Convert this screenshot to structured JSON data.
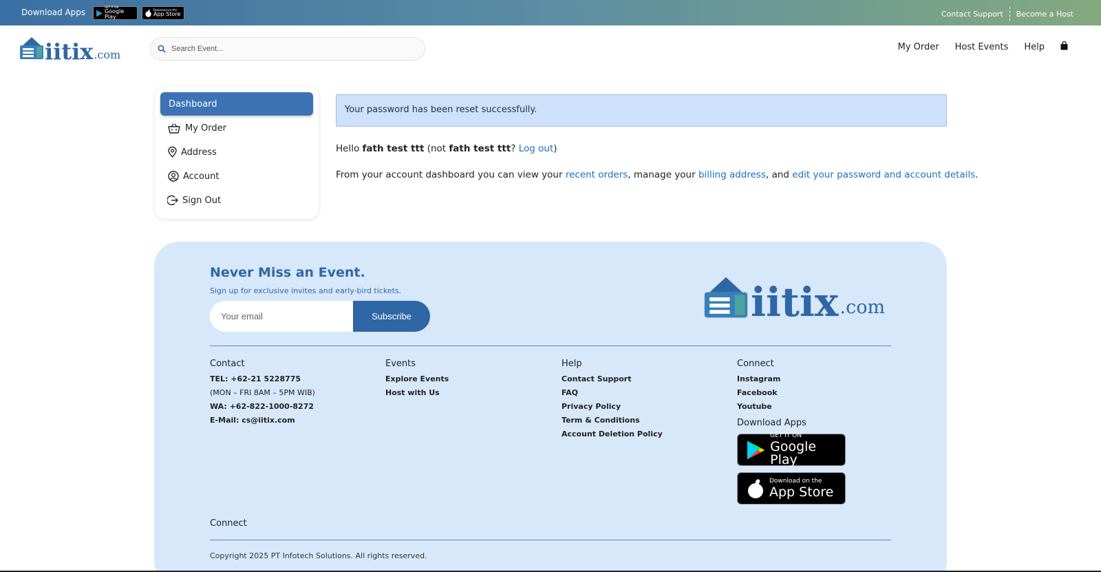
{
  "topbar": {
    "download_label": "Download Apps",
    "google_play_small": {
      "line1": "GET IT ON",
      "line2": "Google Play"
    },
    "app_store_small": {
      "line1": "Download on the",
      "line2": "App Store"
    },
    "contact_support": "Contact Support",
    "become_host": "Become a Host"
  },
  "brand": {
    "word": "iitix",
    "suffix": ".com"
  },
  "search": {
    "placeholder": "Search Event..."
  },
  "nav": {
    "my_order": "My Order",
    "host_events": "Host Events",
    "help": "Help"
  },
  "sidebar": {
    "items": [
      {
        "label": "Dashboard",
        "icon": "none"
      },
      {
        "label": "My Order",
        "icon": "basket-icon"
      },
      {
        "label": "Address",
        "icon": "map-pin-icon"
      },
      {
        "label": "Account",
        "icon": "user-circle-icon"
      },
      {
        "label": "Sign Out",
        "icon": "sign-out-icon"
      }
    ]
  },
  "main": {
    "alert": "Your password has been reset successfully.",
    "hello_prefix": "Hello ",
    "user_name": "fath test ttt",
    "not_prefix": " (not ",
    "user_name_2": "fath test ttt",
    "not_suffix": "? ",
    "logout": "Log out",
    "close_paren": ")",
    "info_1": "From your account dashboard you can view your ",
    "recent_orders": "recent orders",
    "info_2": ", manage your ",
    "billing_address": "billing address",
    "info_3": ", and ",
    "edit_details": "edit your password and account details",
    "info_4": "."
  },
  "footer": {
    "title": "Never Miss an Event.",
    "subtitle": "Sign up for exclusive invites and early-bird tickets.",
    "email_placeholder": "Your email",
    "subscribe": "Subscribe",
    "contact": {
      "head": "Contact",
      "tel": "TEL: +62-21 5228775",
      "hours": "(MON – FRI 8AM – 5PM WIB)",
      "wa": "WA: +62-822-1000-8272",
      "email": "E-Mail: cs@iitix.com"
    },
    "events": {
      "head": "Events",
      "items": [
        "Explore Events",
        "Host with Us"
      ]
    },
    "help": {
      "head": "Help",
      "items": [
        "Contact Support",
        "FAQ",
        "Privacy Policy",
        "Term & Conditions",
        "Account Deletion Policy"
      ]
    },
    "connect": {
      "head": "Connect",
      "items": [
        "Instagram",
        "Facebook",
        "Youtube"
      ],
      "download_head": "Download Apps"
    },
    "google_play": {
      "line1": "GET IT ON",
      "line2": "Google Play"
    },
    "app_store": {
      "line1": "Download on the",
      "line2": "App Store"
    },
    "connect_bottom": "Connect",
    "copyright": "Copyright 2025 PT Infotech Solutions. All rights reserved."
  },
  "colors": {
    "brand_blue": "#2f67a6",
    "active_blue": "#3d72b4",
    "link_blue": "#1b6ec2",
    "footer_bg": "#d8e8fb",
    "alert_bg": "#cfe0fb"
  }
}
